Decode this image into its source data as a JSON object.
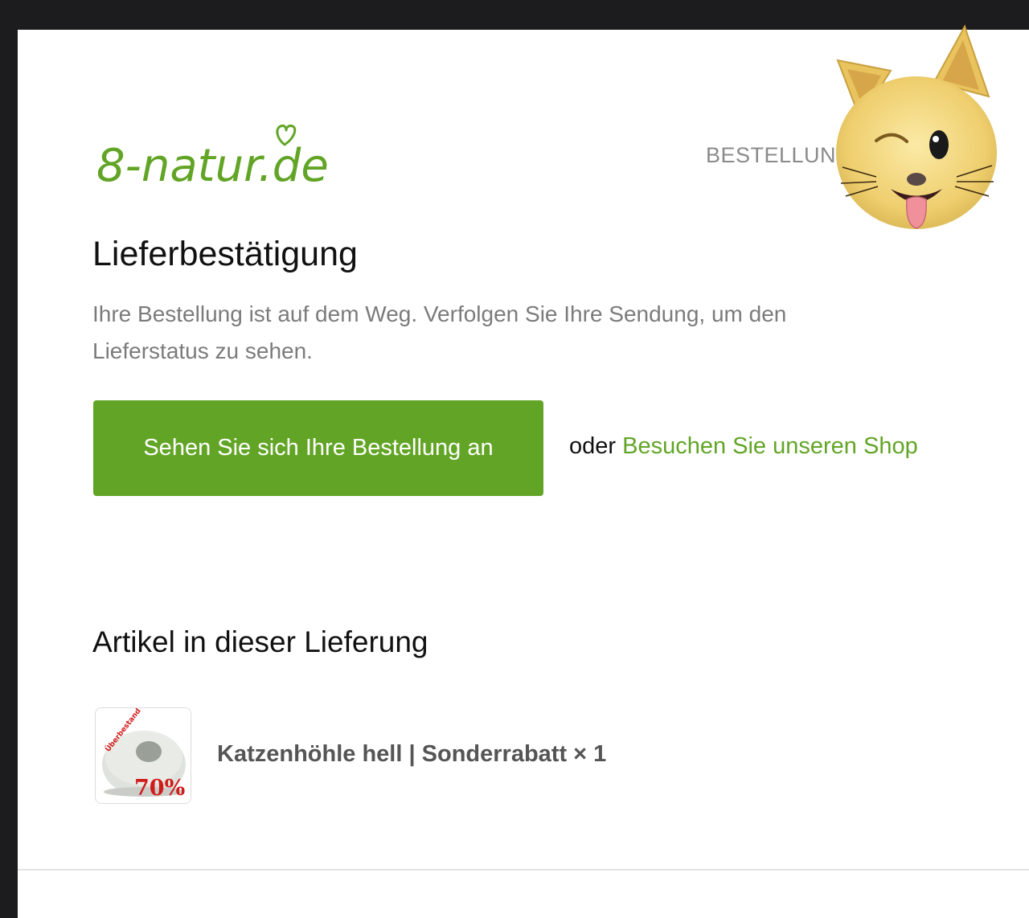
{
  "brand": {
    "logo_text": "8-natur.de",
    "logo_color": "#62a526"
  },
  "header": {
    "right_label": "BESTELLUNG"
  },
  "main": {
    "title": "Lieferbestätigung",
    "intro": "Ihre Bestellung ist auf dem Weg. Verfolgen Sie Ihre Sendung, um den Lieferstatus zu sehen.",
    "cta_label": "Sehen Sie sich Ihre Bestellung an",
    "or_text": "oder",
    "shop_link_label": "Besuchen Sie unseren Shop"
  },
  "items_section": {
    "title": "Artikel in dieser Lieferung",
    "items": [
      {
        "name": "Katzenhöhle hell | Sonderrabatt × 1",
        "image_badge_top": "Überbestand Sonderrabatt",
        "image_badge_percent": "70%"
      }
    ]
  },
  "overlay": {
    "icon": "cat-animoji-icon"
  },
  "colors": {
    "accent": "#62a526",
    "muted_text": "#7b7b7b",
    "item_text": "#555555",
    "badge_red": "#d11a1a"
  }
}
